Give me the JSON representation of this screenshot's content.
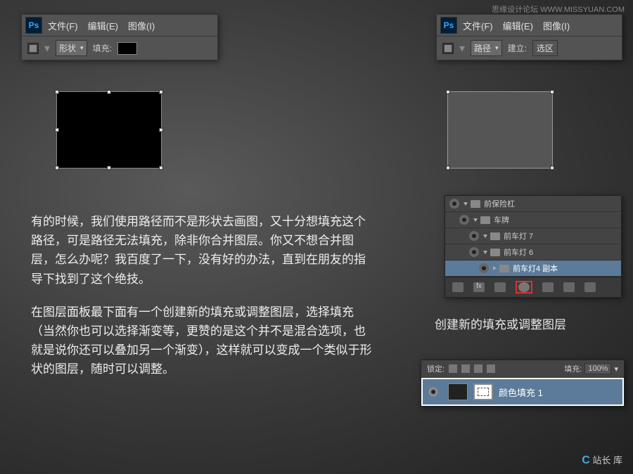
{
  "watermark": {
    "top": "思缘设计论坛  WWW.MISSYUAN.COM",
    "bottom_text": "站长  库"
  },
  "menu": {
    "ps": "Ps",
    "file": "文件(F)",
    "edit": "编辑(E)",
    "image": "图像(I)",
    "shape_mode": "形状",
    "path_mode": "路径",
    "fill_label": "填充:",
    "create_label": "建立:",
    "select_label": "选区"
  },
  "layers1": {
    "item0": "前保险杠",
    "item1": "车牌",
    "item2": "前车灯 7",
    "item3": "前车灯 6",
    "item4": "前车灯4 副本"
  },
  "caption": "创建新的填充或调整图层",
  "para1": "有的时候，我们使用路径而不是形状去画图，又十分想填充这个路径，可是路径无法填充，除非你合并图层。你又不想合并图层，怎么办呢？我百度了一下，没有好的办法，直到在朋友的指导下找到了这个绝技。",
  "para2": "在图层面板最下面有一个创建新的填充或调整图层，选择填充（当然你也可以选择渐变等，更赞的是这个并不是混合选项，也就是说你还可以叠加另一个渐变），这样就可以变成一个类似于形状的图层，随时可以调整。",
  "panel2": {
    "lock_label": "锁定:",
    "fill_label": "填充:",
    "fill_value": "100%",
    "layer_name": "颜色填充 1"
  }
}
